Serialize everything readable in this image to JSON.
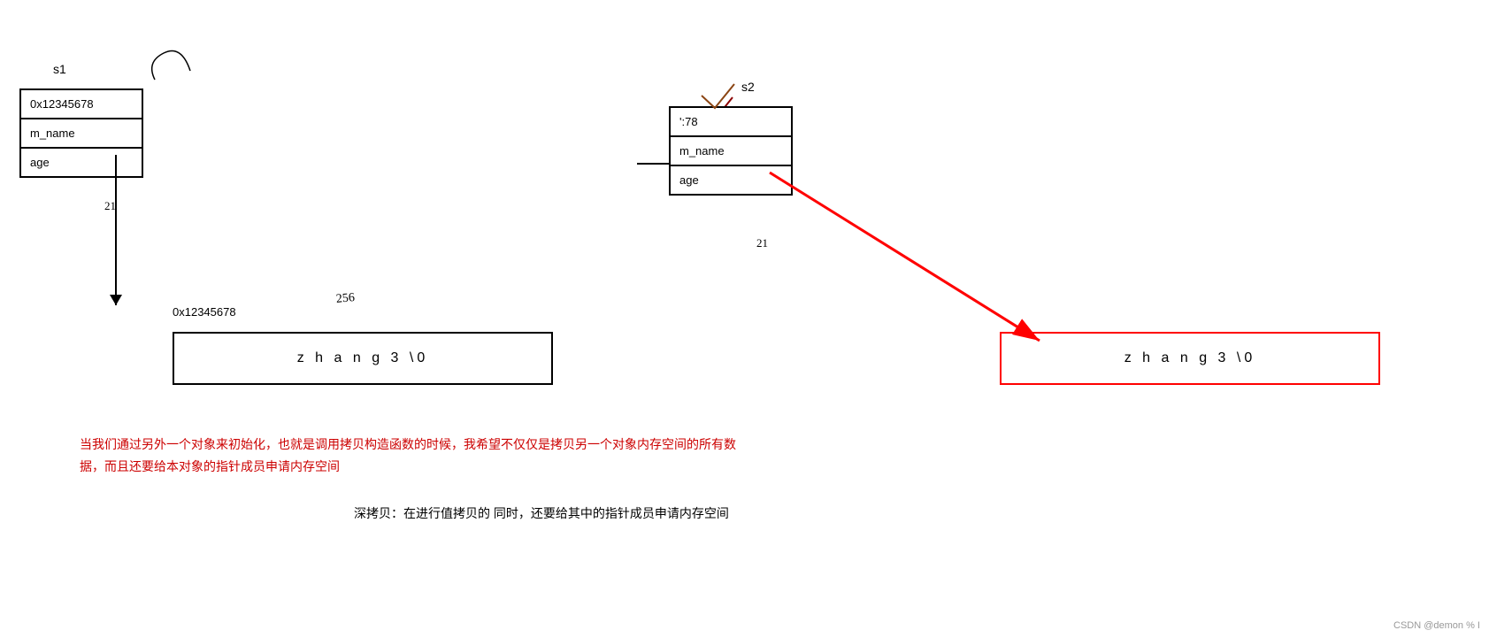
{
  "s1": {
    "label": "s1",
    "address": "0x12345678",
    "m_name": "m_name",
    "age": "age",
    "age_val": "21",
    "heap_addr": "0x12345678",
    "handwritten_256": "256"
  },
  "s2": {
    "label": "s2",
    "address": "':78",
    "m_name": "m_name",
    "age": "age",
    "age_val": "21"
  },
  "string_s1": {
    "content": "z h a n g 3 \\0"
  },
  "string_s2": {
    "content": "z h a n g 3 \\0"
  },
  "description": {
    "line1": "当我们通过另外一个对象来初始化，也就是调用拷贝构造函数的时候，我希望不仅仅是拷贝另一个对象内存空间的所有数",
    "line2": "据，而且还要给本对象的指针成员申请内存空间",
    "deep_copy": "深拷贝：在进行值拷贝的 同时，还要给其中的指针成员申请内存空间"
  },
  "watermark": "CSDN @demon % I"
}
